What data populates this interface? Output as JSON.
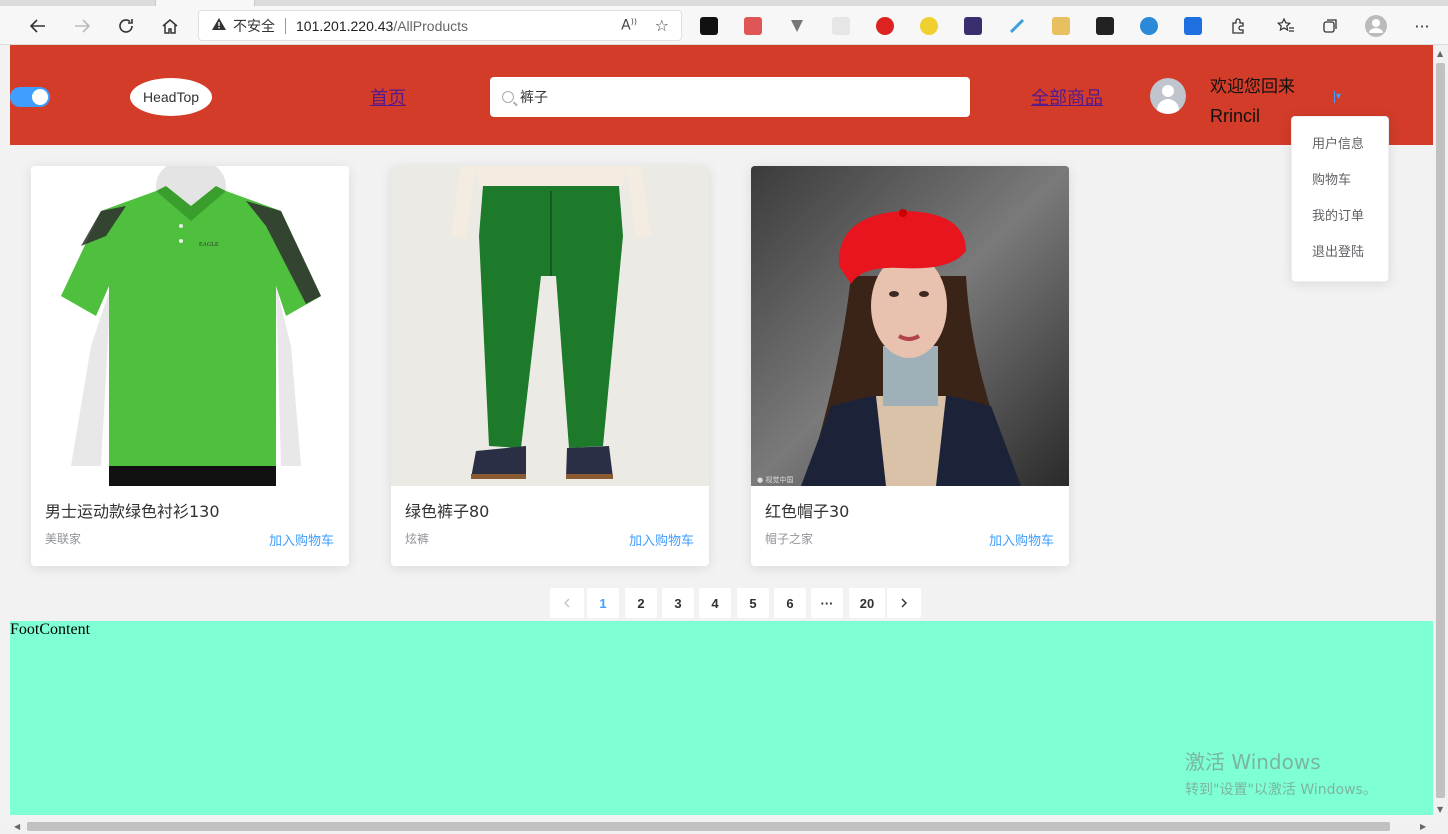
{
  "browser": {
    "address": {
      "security_label": "不安全",
      "url_host": "101.201.220.43",
      "url_path": "/AllProducts"
    }
  },
  "header": {
    "logo_text": "HeadTop",
    "nav_home": "首页",
    "search_value": "裤子",
    "nav_all_products": "全部商品",
    "welcome_text": "欢迎您回来",
    "username": "Rrincil",
    "toggle_on": true
  },
  "user_menu": {
    "items": [
      {
        "label": "用户信息"
      },
      {
        "label": "购物车"
      },
      {
        "label": "我的订单"
      },
      {
        "label": "退出登陆"
      }
    ]
  },
  "products": [
    {
      "title": "男士运动款绿色衬衫130",
      "shop": "美联家",
      "action": "加入购物车"
    },
    {
      "title": "绿色裤子80",
      "shop": "炫裤",
      "action": "加入购物车"
    },
    {
      "title": "红色帽子30",
      "shop": "帽子之家",
      "action": "加入购物车"
    }
  ],
  "pagination": {
    "pages": [
      "1",
      "2",
      "3",
      "4",
      "5",
      "6",
      "···",
      "20"
    ],
    "current": "1"
  },
  "footer": {
    "text": "FootContent"
  },
  "watermark": {
    "line1": "激活 Windows",
    "line2": "转到\"设置\"以激活 Windows。"
  },
  "colors": {
    "header_bg": "#d23c29",
    "footer_bg": "#7fffd4",
    "accent": "#409eff"
  }
}
